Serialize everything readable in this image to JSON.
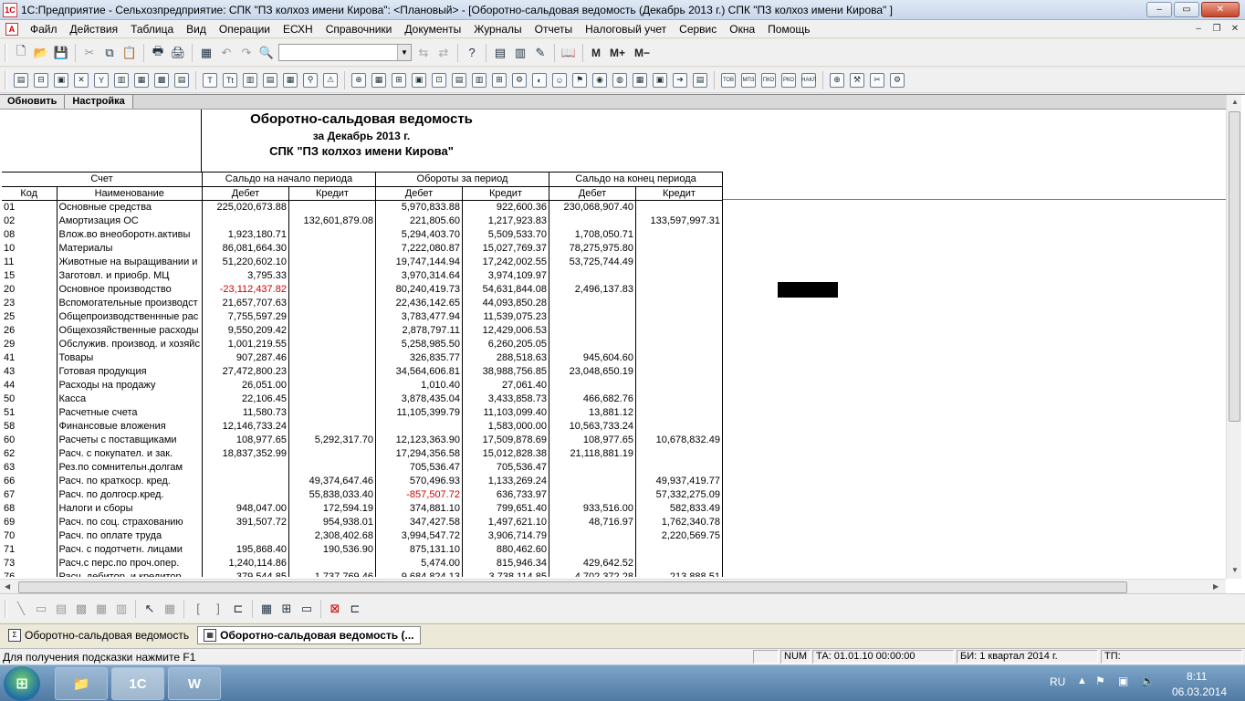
{
  "window": {
    "title": "1С:Предприятие - Сельхозпредприятие: СПК \"ПЗ колхоз имени Кирова\": <Плановый> - [Оборотно-сальдовая ведомость (Декабрь 2013 г.) СПК \"ПЗ колхоз имени Кирова\" ]",
    "minimize": "–",
    "maximize": "▭",
    "close": "✕"
  },
  "menu": [
    "Файл",
    "Действия",
    "Таблица",
    "Вид",
    "Операции",
    "ЕСХН",
    "Справочники",
    "Документы",
    "Журналы",
    "Отчеты",
    "Налоговый учет",
    "Сервис",
    "Окна",
    "Помощь"
  ],
  "toolbar": {
    "m_label": "M",
    "m_plus_label": "M+",
    "m_minus_label": "M−",
    "combo_value": ""
  },
  "sheet_buttons": [
    "Обновить",
    "Настройка"
  ],
  "report": {
    "title": "Оборотно-сальдовая ведомость",
    "period": "за Декабрь 2013 г.",
    "org": "СПК \"ПЗ колхоз имени Кирова\"",
    "header_groups": [
      "Счет",
      "Сальдо на начало периода",
      "Обороты за период",
      "Сальдо на конец периода"
    ],
    "header_cols": [
      "Код",
      "Наименование",
      "Дебет",
      "Кредит",
      "Дебет",
      "Кредит",
      "Дебет",
      "Кредит"
    ],
    "rows": [
      {
        "code": "01",
        "name": "Основные средства",
        "sd": "225,020,673.88",
        "sk": "",
        "od": "5,970,833.88",
        "ok": "922,600.36",
        "ed": "230,068,907.40",
        "ek": ""
      },
      {
        "code": "02",
        "name": "Амортизация ОС",
        "sd": "",
        "sk": "132,601,879.08",
        "od": "221,805.60",
        "ok": "1,217,923.83",
        "ed": "",
        "ek": "133,597,997.31"
      },
      {
        "code": "08",
        "name": "Влож.во внеоборотн.активы",
        "sd": "1,923,180.71",
        "sk": "",
        "od": "5,294,403.70",
        "ok": "5,509,533.70",
        "ed": "1,708,050.71",
        "ek": ""
      },
      {
        "code": "10",
        "name": "Материалы",
        "sd": "86,081,664.30",
        "sk": "",
        "od": "7,222,080.87",
        "ok": "15,027,769.37",
        "ed": "78,275,975.80",
        "ek": ""
      },
      {
        "code": "11",
        "name": "Животные на выращивании и",
        "sd": "51,220,602.10",
        "sk": "",
        "od": "19,747,144.94",
        "ok": "17,242,002.55",
        "ed": "53,725,744.49",
        "ek": ""
      },
      {
        "code": "15",
        "name": "Заготовл. и приобр. МЦ",
        "sd": "3,795.33",
        "sk": "",
        "od": "3,970,314.64",
        "ok": "3,974,109.97",
        "ed": "",
        "ek": ""
      },
      {
        "code": "20",
        "name": "Основное производство",
        "sd": "-23,112,437.82",
        "sk": "",
        "od": "80,240,419.73",
        "ok": "54,631,844.08",
        "ed": "2,496,137.83",
        "ek": ""
      },
      {
        "code": "23",
        "name": "Вспомогательные производст",
        "sd": "21,657,707.63",
        "sk": "",
        "od": "22,436,142.65",
        "ok": "44,093,850.28",
        "ed": "",
        "ek": ""
      },
      {
        "code": "25",
        "name": "Общепроизводственнные рас",
        "sd": "7,755,597.29",
        "sk": "",
        "od": "3,783,477.94",
        "ok": "11,539,075.23",
        "ed": "",
        "ek": ""
      },
      {
        "code": "26",
        "name": "Общехозяйственные расходы",
        "sd": "9,550,209.42",
        "sk": "",
        "od": "2,878,797.11",
        "ok": "12,429,006.53",
        "ed": "",
        "ek": ""
      },
      {
        "code": "29",
        "name": "Обслужив. производ. и хозяйс",
        "sd": "1,001,219.55",
        "sk": "",
        "od": "5,258,985.50",
        "ok": "6,260,205.05",
        "ed": "",
        "ek": ""
      },
      {
        "code": "41",
        "name": "Товары",
        "sd": "907,287.46",
        "sk": "",
        "od": "326,835.77",
        "ok": "288,518.63",
        "ed": "945,604.60",
        "ek": ""
      },
      {
        "code": "43",
        "name": "Готовая продукция",
        "sd": "27,472,800.23",
        "sk": "",
        "od": "34,564,606.81",
        "ok": "38,988,756.85",
        "ed": "23,048,650.19",
        "ek": ""
      },
      {
        "code": "44",
        "name": "Расходы на продажу",
        "sd": "26,051.00",
        "sk": "",
        "od": "1,010.40",
        "ok": "27,061.40",
        "ed": "",
        "ek": ""
      },
      {
        "code": "50",
        "name": "Касса",
        "sd": "22,106.45",
        "sk": "",
        "od": "3,878,435.04",
        "ok": "3,433,858.73",
        "ed": "466,682.76",
        "ek": ""
      },
      {
        "code": "51",
        "name": "Расчетные счета",
        "sd": "11,580.73",
        "sk": "",
        "od": "11,105,399.79",
        "ok": "11,103,099.40",
        "ed": "13,881.12",
        "ek": ""
      },
      {
        "code": "58",
        "name": "Финансовые вложения",
        "sd": "12,146,733.24",
        "sk": "",
        "od": "",
        "ok": "1,583,000.00",
        "ed": "10,563,733.24",
        "ek": ""
      },
      {
        "code": "60",
        "name": "Расчеты с поставщиками",
        "sd": "108,977.65",
        "sk": "5,292,317.70",
        "od": "12,123,363.90",
        "ok": "17,509,878.69",
        "ed": "108,977.65",
        "ek": "10,678,832.49"
      },
      {
        "code": "62",
        "name": "Расч. с покупател. и зак.",
        "sd": "18,837,352.99",
        "sk": "",
        "od": "17,294,356.58",
        "ok": "15,012,828.38",
        "ed": "21,118,881.19",
        "ek": ""
      },
      {
        "code": "63",
        "name": "Рез.по сомнительн.долгам",
        "sd": "",
        "sk": "",
        "od": "705,536.47",
        "ok": "705,536.47",
        "ed": "",
        "ek": ""
      },
      {
        "code": "66",
        "name": "Расч. по краткоср. кред.",
        "sd": "",
        "sk": "49,374,647.46",
        "od": "570,496.93",
        "ok": "1,133,269.24",
        "ed": "",
        "ek": "49,937,419.77"
      },
      {
        "code": "67",
        "name": "Расч. по долгоср.кред.",
        "sd": "",
        "sk": "55,838,033.40",
        "od": "-857,507.72",
        "ok": "636,733.97",
        "ed": "",
        "ek": "57,332,275.09"
      },
      {
        "code": "68",
        "name": "Налоги и сборы",
        "sd": "948,047.00",
        "sk": "172,594.19",
        "od": "374,881.10",
        "ok": "799,651.40",
        "ed": "933,516.00",
        "ek": "582,833.49"
      },
      {
        "code": "69",
        "name": "Расч. по соц. страхованию",
        "sd": "391,507.72",
        "sk": "954,938.01",
        "od": "347,427.58",
        "ok": "1,497,621.10",
        "ed": "48,716.97",
        "ek": "1,762,340.78"
      },
      {
        "code": "70",
        "name": "Расч. по оплате труда",
        "sd": "",
        "sk": "2,308,402.68",
        "od": "3,994,547.72",
        "ok": "3,906,714.79",
        "ed": "",
        "ek": "2,220,569.75"
      },
      {
        "code": "71",
        "name": "Расч. с подотчетн. лицами",
        "sd": "195,868.40",
        "sk": "190,536.90",
        "od": "875,131.10",
        "ok": "880,462.60",
        "ed": "",
        "ek": ""
      },
      {
        "code": "73",
        "name": "Расч.с перс.по проч.опер.",
        "sd": "1,240,114.86",
        "sk": "",
        "od": "5,474.00",
        "ok": "815,946.34",
        "ed": "429,642.52",
        "ek": ""
      },
      {
        "code": "76",
        "name": "Расч. дебитор. и кредитор.",
        "sd": "379,544.85",
        "sk": "1,737,769.46",
        "od": "9,684,824.13",
        "ok": "3,738,114.85",
        "ed": "4,702,372.28",
        "ek": "213,888.51"
      }
    ]
  },
  "window_tabs": [
    "Оборотно-сальдовая ведомость",
    "Оборотно-сальдовая ведомость (..."
  ],
  "status": {
    "hint": "Для получения подсказки нажмите F1",
    "num": "NUM",
    "ta": "ТА: 01.01.10  00:00:00",
    "bi": "БИ: 1 квартал 2014 г.",
    "tp": "ТП:"
  },
  "taskbar": {
    "lang": "RU",
    "time": "8:11",
    "date": "06.03.2014"
  }
}
